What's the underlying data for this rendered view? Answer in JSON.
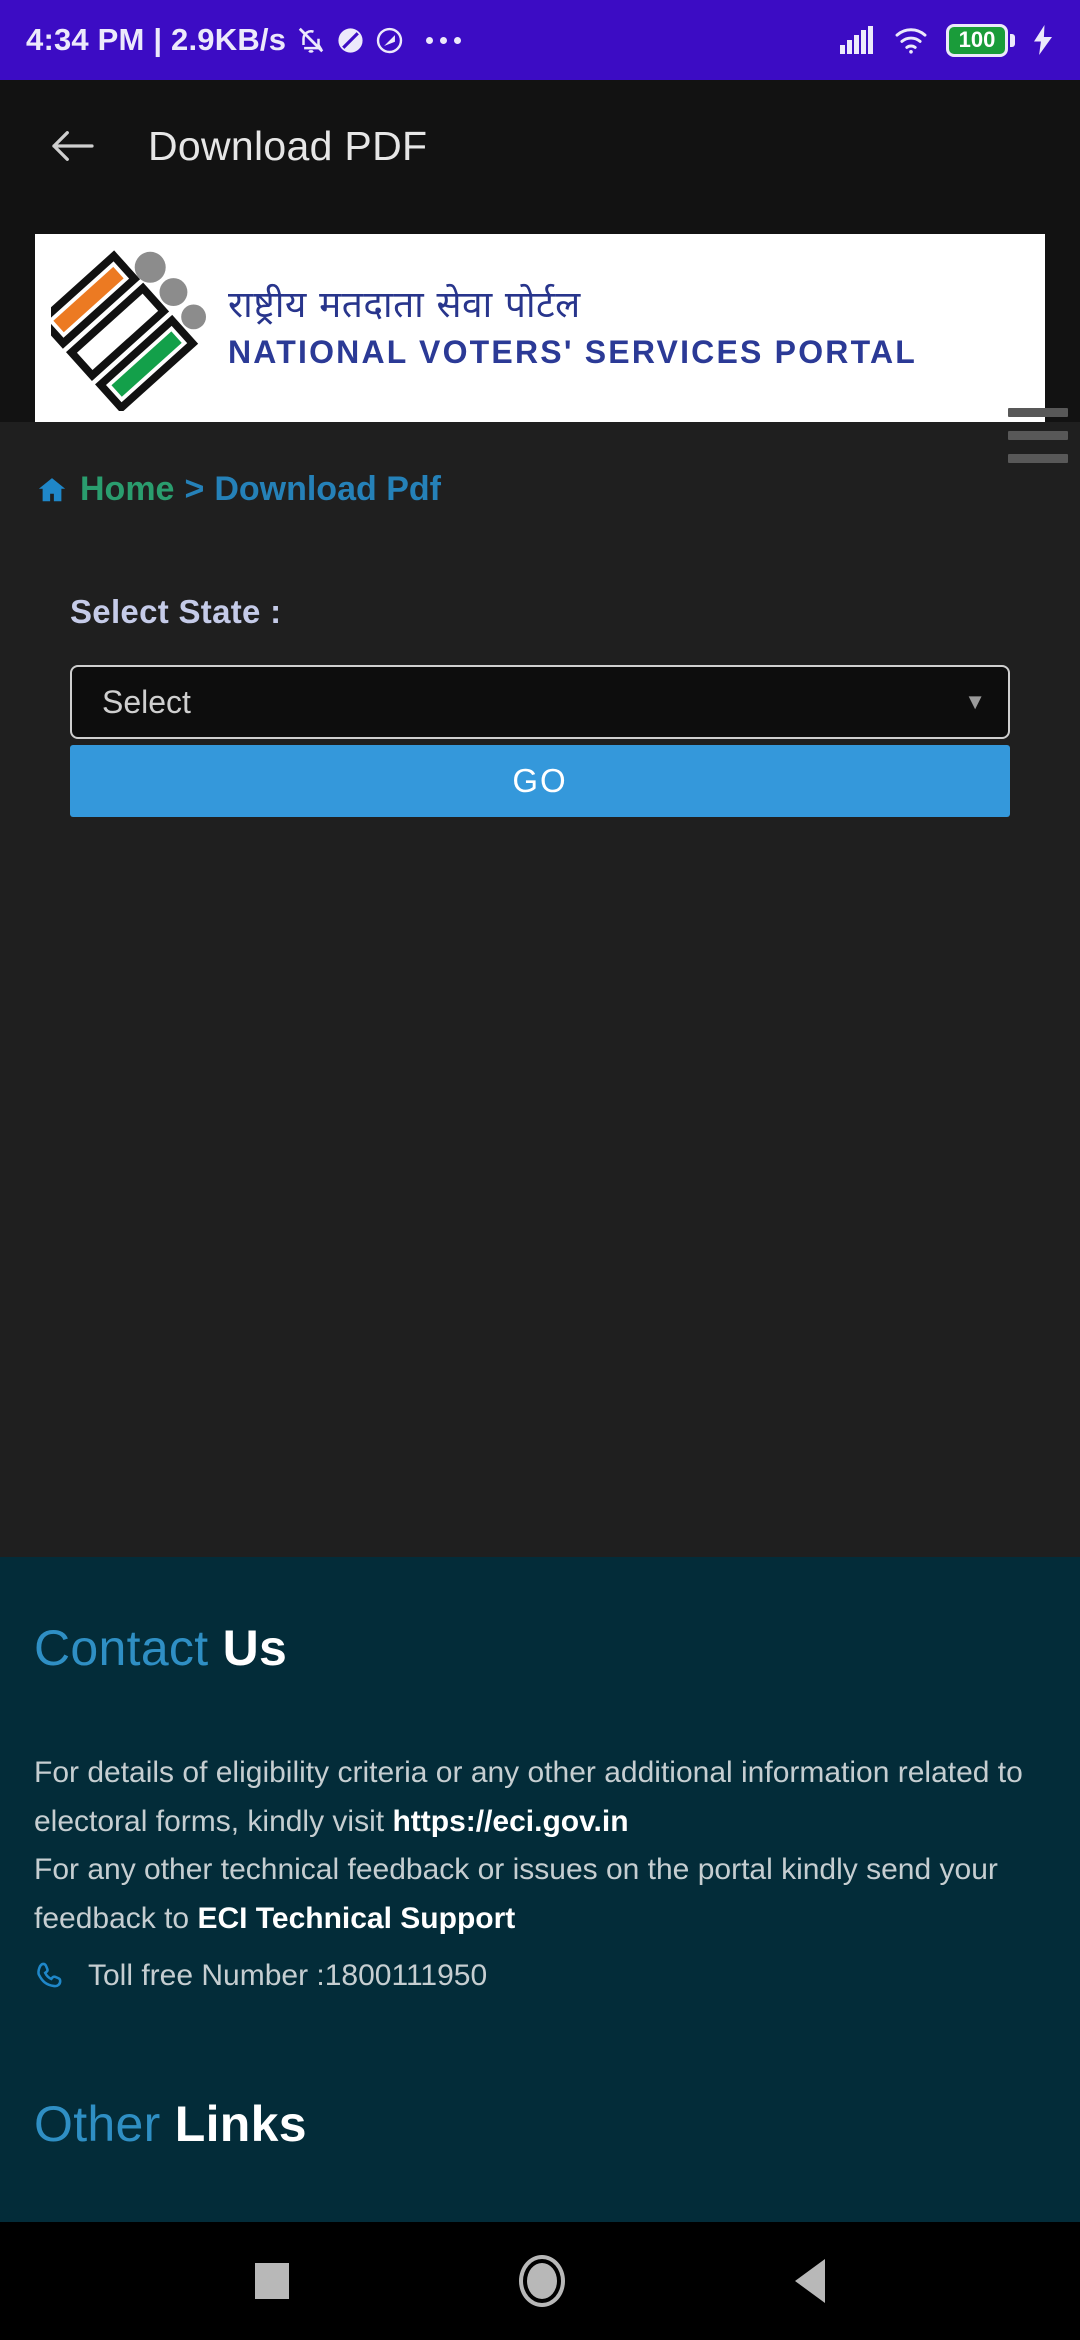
{
  "status_bar": {
    "clock": "4:34 PM | 2.9KB/s",
    "battery_level": "100",
    "icons": [
      "bell-mute-icon",
      "do-not-disturb-icon",
      "data-saver-icon",
      "overflow-dots-icon",
      "signal-bars-icon",
      "wifi-icon",
      "battery-icon",
      "charging-bolt-icon"
    ],
    "background_color": "#3c0cc4"
  },
  "app_bar": {
    "title": "Download PDF",
    "back_icon": "arrow-left-icon"
  },
  "banner": {
    "hindi_title": "राष्ट्रीय मतदाता सेवा पोर्टल",
    "english_title": "NATIONAL VOTERS' SERVICES PORTAL",
    "logo_icon": "eci-ballot-logo-icon",
    "menu_icon": "hamburger-menu-icon"
  },
  "breadcrumb": {
    "home_icon": "home-icon",
    "home_label": "Home",
    "separator": ">",
    "current_label": "Download Pdf",
    "home_color": "#2a9d6e",
    "current_color": "#2581b8"
  },
  "form": {
    "state_label": "Select State :",
    "state_value": "Select",
    "state_placeholder": "Select",
    "caret_icon": "chevron-down-icon",
    "go_label": "GO",
    "go_color": "#3498db"
  },
  "footer": {
    "contact_heading_primary": "Contact",
    "contact_heading_secondary": "Us",
    "paragraph_1_part_1": "For details of eligibility criteria or any other additional information related to electoral forms, kindly visit ",
    "paragraph_1_link": "https://eci.gov.in",
    "paragraph_2_part_1": "For any other technical feedback or issues on the portal kindly send your feedback to ",
    "paragraph_2_bold": "ECI Technical Support",
    "phone_icon": "phone-icon",
    "toll_free_text": "Toll free Number :1800111950",
    "other_links_primary": "Other",
    "other_links_secondary": "Links",
    "background_color": "#032c39"
  },
  "nav_bar": {
    "recents_icon": "square-recents-icon",
    "home_icon": "circle-home-icon",
    "back_icon": "triangle-back-icon"
  }
}
